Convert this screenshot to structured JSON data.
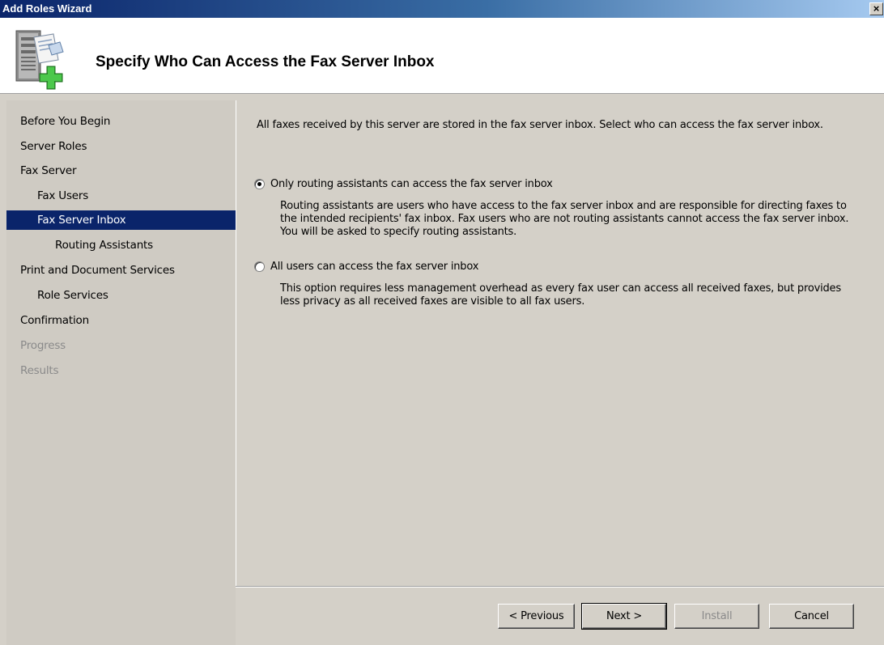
{
  "window": {
    "title": "Add Roles Wizard",
    "close_symbol": "×"
  },
  "header": {
    "title": "Specify Who Can Access the Fax Server Inbox",
    "icon": "server-role-add-icon"
  },
  "sidebar": {
    "items": [
      {
        "label": "Before You Begin",
        "state": "normal",
        "indent": 0
      },
      {
        "label": "Server Roles",
        "state": "normal",
        "indent": 0
      },
      {
        "label": "Fax Server",
        "state": "normal",
        "indent": 0
      },
      {
        "label": "Fax Users",
        "state": "normal",
        "indent": 1
      },
      {
        "label": "Fax Server Inbox",
        "state": "active",
        "indent": 1
      },
      {
        "label": "Routing Assistants",
        "state": "normal",
        "indent": 2
      },
      {
        "label": "Print and Document Services",
        "state": "normal",
        "indent": 0
      },
      {
        "label": "Role Services",
        "state": "normal",
        "indent": 1
      },
      {
        "label": "Confirmation",
        "state": "normal",
        "indent": 0
      },
      {
        "label": "Progress",
        "state": "disabled",
        "indent": 0
      },
      {
        "label": "Results",
        "state": "disabled",
        "indent": 0
      }
    ]
  },
  "main": {
    "intro": "All faxes received by this server are stored in the fax server inbox. Select who can access the fax server inbox.",
    "options": [
      {
        "label": "Only routing assistants can access the fax server inbox",
        "selected": true,
        "description": "Routing assistants are users who have access to the fax server inbox and are responsible for directing faxes to the intended recipients' fax inbox. Fax users who are not routing assistants cannot access the fax server inbox. You will be asked to specify routing assistants."
      },
      {
        "label": "All users can access the fax server inbox",
        "selected": false,
        "description": "This option requires less management overhead as every fax user can access all received faxes, but provides less privacy as all received faxes are visible to all fax users."
      }
    ]
  },
  "buttons": {
    "previous": "< Previous",
    "next": "Next >",
    "install": "Install",
    "cancel": "Cancel"
  },
  "colors": {
    "title_bar_start": "#0a246a",
    "selection": "#0a246a",
    "dialog_face": "#d4d0c8",
    "disabled_text": "#8a8a8a"
  }
}
